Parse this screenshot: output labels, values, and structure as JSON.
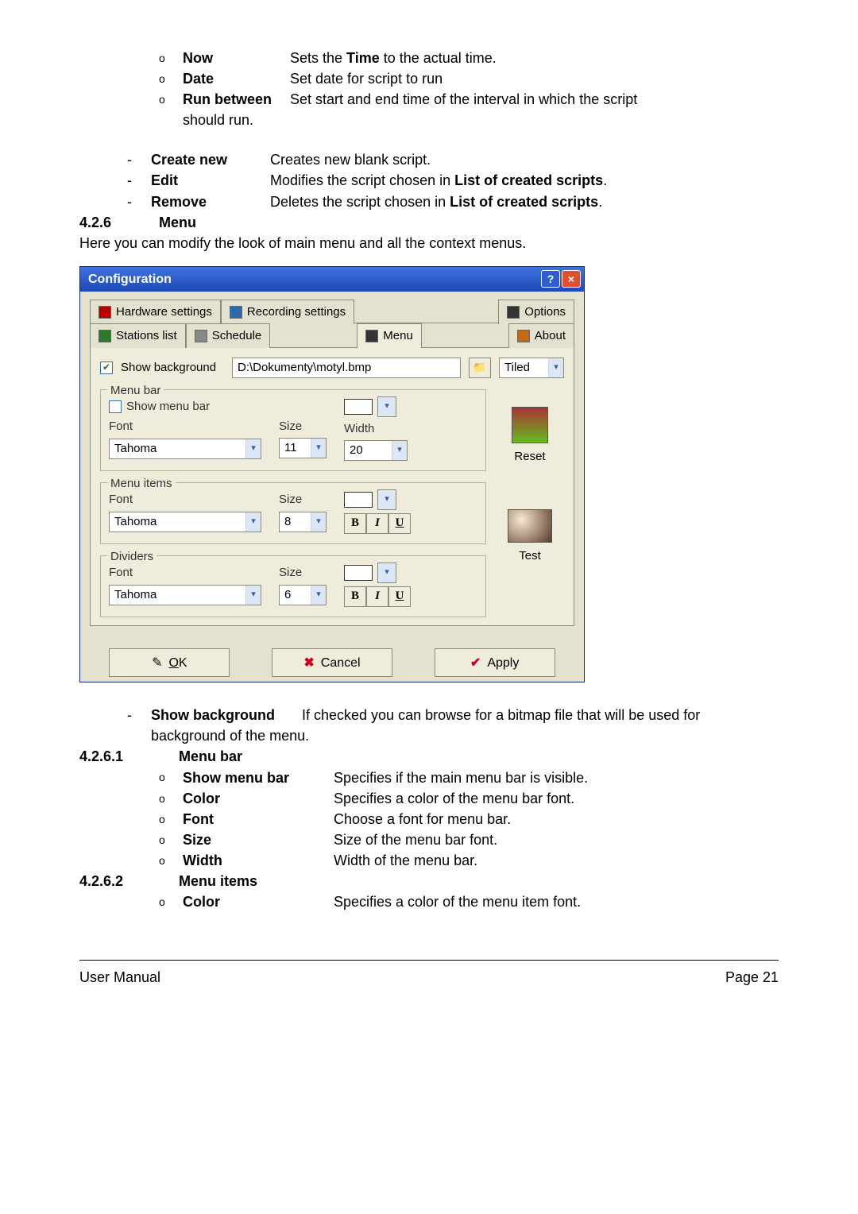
{
  "top_list": [
    {
      "term": "Now",
      "desc": "Sets the <b>Time</b> to the actual time."
    },
    {
      "term": "Date",
      "desc": "Set date for script to run"
    },
    {
      "term": "Run between",
      "desc": "Set start and end time of the interval in which the script should run."
    }
  ],
  "mid_list": [
    {
      "term": "Create new",
      "desc": "Creates new blank script."
    },
    {
      "term": "Edit",
      "desc": "Modifies the script chosen in <b>List of created scripts</b>."
    },
    {
      "term": "Remove",
      "desc": "Deletes the script chosen in <b>List of created scripts</b>."
    }
  ],
  "s426": {
    "num": "4.2.6",
    "title": "Menu",
    "intro": "Here you can modify the look of main menu and all the context menus."
  },
  "dialog": {
    "title": "Configuration",
    "tabs": [
      "Hardware settings",
      "Recording settings",
      "Options",
      "Stations list",
      "Schedule",
      "Menu",
      "About"
    ],
    "active_tab": "Menu",
    "show_background_label": "Show background",
    "bg_path": "D:\\Dokumenty\\motyl.bmp",
    "tile_combo": "Tiled",
    "menubar": {
      "legend": "Menu bar",
      "show_label": "Show menu bar",
      "font_label": "Font",
      "font_value": "Tahoma",
      "size_label": "Size",
      "size_value": "11",
      "width_label": "Width",
      "width_value": "20",
      "reset": "Reset"
    },
    "menuitems": {
      "legend": "Menu items",
      "font_label": "Font",
      "font_value": "Tahoma",
      "size_label": "Size",
      "size_value": "8",
      "style": [
        "B",
        "I",
        "U"
      ]
    },
    "dividers": {
      "legend": "Dividers",
      "font_label": "Font",
      "font_value": "Tahoma",
      "size_label": "Size",
      "size_value": "6",
      "style": [
        "B",
        "I",
        "U"
      ],
      "test": "Test"
    },
    "buttons": {
      "ok": "OK",
      "cancel": "Cancel",
      "apply": "Apply"
    }
  },
  "show_bg": {
    "term": "Show background",
    "desc": "If checked you can browse for a bitmap file that will be used for background of the menu."
  },
  "s4261": {
    "num": "4.2.6.1",
    "title": "Menu bar"
  },
  "menu_bar_items": [
    {
      "term": "Show menu bar",
      "desc": "Specifies if the main menu bar is visible."
    },
    {
      "term": "Color",
      "desc": "Specifies a color of the menu bar font."
    },
    {
      "term": "Font",
      "desc": "Choose a font for menu bar."
    },
    {
      "term": "Size",
      "desc": "Size of the menu bar font."
    },
    {
      "term": "Width",
      "desc": "Width of the menu bar."
    }
  ],
  "s4262": {
    "num": "4.2.6.2",
    "title": "Menu items"
  },
  "menu_items_items": [
    {
      "term": "Color",
      "desc": "Specifies a color of the menu item font."
    }
  ],
  "footer": {
    "left": "User Manual",
    "right": "Page 21"
  }
}
